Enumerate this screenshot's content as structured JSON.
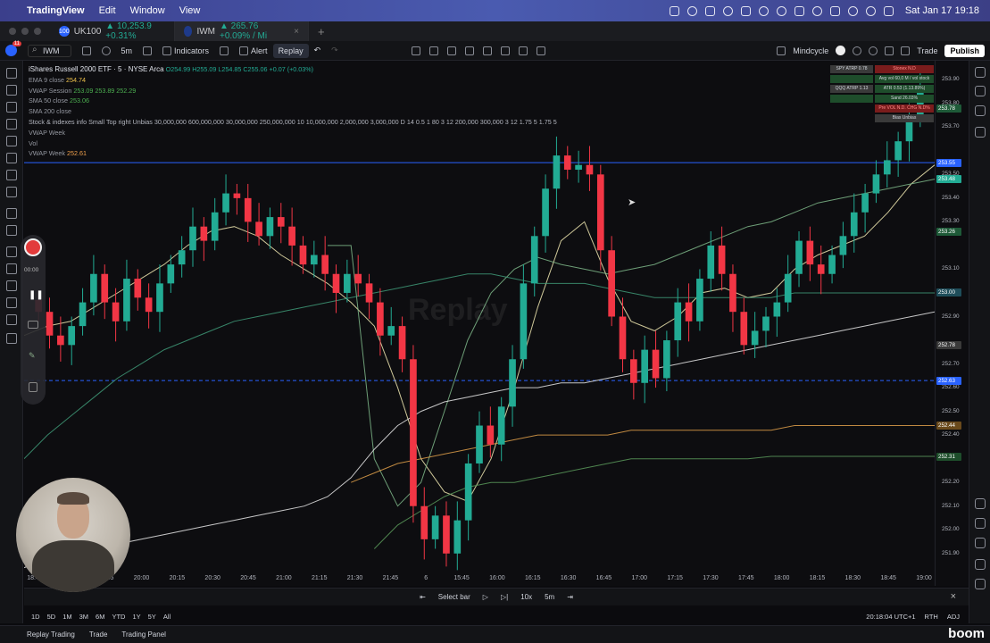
{
  "menubar": {
    "app": "TradingView",
    "menus": [
      "Edit",
      "Window",
      "View"
    ],
    "clock": "Sat Jan 17  19:18"
  },
  "tabs": [
    {
      "icon": "100",
      "symbol": "UK100",
      "change": "▲ 10,253.9 +0.31%"
    },
    {
      "icon": "",
      "symbol": "IWM",
      "change": "▲ 265.76 +0.09% / Mi"
    }
  ],
  "toolbar": {
    "symbol": "IWM",
    "interval": "5m",
    "indicators": "Indicators",
    "alert": "Alert",
    "replay": "Replay",
    "layout_name": "Mindcycle",
    "trade": "Trade",
    "publish": "Publish",
    "notif_count": "11"
  },
  "legend": {
    "title": "iShares Russell 2000 ETF · 5 · NYSE Arca",
    "ohlc": "O254.99 H255.09 L254.85 C255.06 +0.07 (+0.03%)",
    "lines": [
      {
        "label": "EMA 9 close",
        "value": "254.74",
        "color": "#f0c24c"
      },
      {
        "label": "VWAP Session",
        "value": "253.09  253.89  252.29",
        "color": "#4caf50"
      },
      {
        "label": "SMA 50 close",
        "value": "253.06",
        "color": "#4caf50"
      },
      {
        "label": "SMA 200 close",
        "value": "",
        "color": "#6f7280"
      },
      {
        "label": "Stock & indexes info Small Top right Unbias 30,000,000 600,000,000 30,000,000 250,000,000 10 10,000,000 2,000,000 3,000,000 D 14 0.5 1 80 3 12 200,000 300,000 3 12 1.75 5 1.75 5",
        "value": "",
        "color": "#b2b5be"
      },
      {
        "label": "VWAP Week",
        "value": "",
        "color": "#6f7280"
      },
      {
        "label": "Vol",
        "value": "",
        "color": "#6f7280"
      },
      {
        "label": "VWAP Week",
        "value": "252.61",
        "color": "#f0a04c"
      }
    ]
  },
  "watermark": "Replay",
  "info_table": {
    "rows": [
      [
        {
          "t": "SPY ATRP 0.78",
          "bg": "#3a3a3a"
        },
        {
          "t": "Stonex N.D",
          "bg": "#7a1c1c"
        }
      ],
      [
        {
          "t": "",
          "bg": "#1e4d2b"
        },
        {
          "t": "Avg vol 60,0 M / vol stock",
          "bg": "#1e4d2b"
        }
      ],
      [
        {
          "t": "QQQ ATRP 1.13",
          "bg": "#3a3a3a"
        },
        {
          "t": "ATR 0.53 (1.13.89%)",
          "bg": "#1e4d2b"
        }
      ],
      [
        {
          "t": "",
          "bg": "#1e4d2b"
        },
        {
          "t": "Sand 26.03%",
          "bg": "#1e4d2b"
        }
      ],
      [
        {
          "t": "",
          "bg": "#0d0d10"
        },
        {
          "t": "Pre VOL N.D. CHG N.D%",
          "bg": "#7a1c1c"
        }
      ],
      [
        {
          "t": "",
          "bg": "#0d0d10"
        },
        {
          "t": "Bias Unbias",
          "bg": "#3a3a3a"
        }
      ]
    ]
  },
  "chart_data": {
    "type": "candlestick",
    "ylim": [
      251.82,
      253.98
    ],
    "price_ticks": [
      "253.90",
      "253.80",
      "253.70",
      "253.50",
      "253.40",
      "253.30",
      "253.10",
      "252.90",
      "252.70",
      "252.60",
      "252.50",
      "252.40",
      "252.20",
      "252.10",
      "252.00",
      "251.90"
    ],
    "price_tags": [
      {
        "t": "253.78",
        "v": 253.78,
        "c": "#1e5a38"
      },
      {
        "t": "253.55",
        "v": 253.55,
        "c": "#2962ff"
      },
      {
        "t": "253.48",
        "v": 253.48,
        "c": "#22ab94"
      },
      {
        "t": "253.26",
        "v": 253.26,
        "c": "#1e5a38"
      },
      {
        "t": "253.00",
        "v": 253.0,
        "c": "#1e4d5a"
      },
      {
        "t": "252.78",
        "v": 252.78,
        "c": "#3a3a3a"
      },
      {
        "t": "252.63",
        "v": 252.63,
        "c": "#2962ff"
      },
      {
        "t": "252.44",
        "v": 252.44,
        "c": "#6a4a1c"
      },
      {
        "t": "252.31",
        "v": 252.31,
        "c": "#1e4d2b"
      }
    ],
    "time_ticks": [
      "18:45",
      "19:30",
      "19:45",
      "20:00",
      "20:15",
      "20:30",
      "20:45",
      "21:00",
      "21:15",
      "21:30",
      "21:45",
      "6",
      "15:45",
      "16:00",
      "16:15",
      "16:30",
      "16:45",
      "17:00",
      "17:15",
      "17:30",
      "17:45",
      "18:00",
      "18:15",
      "18:30",
      "18:45",
      "19:00"
    ],
    "hlines": [
      {
        "v": 253.55,
        "color": "#2962ff",
        "style": "solid"
      },
      {
        "v": 252.63,
        "color": "#2962ff",
        "style": "dashed"
      }
    ],
    "closes": [
      252.92,
      252.82,
      252.78,
      252.86,
      252.96,
      253.08,
      252.96,
      252.88,
      253.06,
      252.98,
      252.92,
      253.04,
      253.12,
      253.18,
      253.28,
      253.22,
      253.34,
      253.42,
      253.4,
      253.3,
      253.24,
      253.32,
      253.28,
      253.2,
      253.12,
      253.16,
      253.08,
      253.0,
      253.08,
      253.04,
      252.96,
      252.82,
      252.86,
      252.72,
      252.1,
      251.96,
      252.06,
      251.9,
      252.04,
      252.28,
      252.44,
      252.36,
      252.52,
      252.72,
      253.04,
      253.24,
      253.44,
      253.58,
      253.52,
      253.54,
      253.5,
      253.18,
      252.9,
      252.72,
      252.62,
      252.76,
      252.64,
      252.8,
      252.96,
      252.88,
      253.06,
      253.2,
      253.08,
      252.92,
      252.78,
      252.84,
      252.9,
      252.96,
      253.08,
      253.22,
      253.12,
      253.08,
      253.16,
      253.24,
      253.34,
      253.42,
      253.5,
      253.56,
      253.64,
      253.74,
      253.86
    ],
    "series": [
      {
        "name": "EMA 9",
        "color": "#f0e8b0",
        "values": [
          252.82,
          252.86,
          252.88,
          252.94,
          253.0,
          253.06,
          253.12,
          253.2,
          253.26,
          253.28,
          253.24,
          253.16,
          253.1,
          253.04,
          252.96,
          252.86,
          252.6,
          252.3,
          252.16,
          252.12,
          252.3,
          252.6,
          252.94,
          253.22,
          253.3,
          253.06,
          252.88,
          252.84,
          252.9,
          253.0,
          253.02,
          252.98,
          253.0,
          253.1,
          253.16,
          253.2,
          253.24,
          253.34,
          253.46,
          253.54
        ]
      },
      {
        "name": "VWAP Session",
        "color": "#7fb88a",
        "values": [
          null,
          null,
          null,
          null,
          null,
          null,
          null,
          null,
          null,
          null,
          null,
          null,
          null,
          253.2,
          253.2,
          252.3,
          252.1,
          252.2,
          252.5,
          252.8,
          253.0,
          253.1,
          253.15,
          253.12,
          253.1,
          253.08,
          253.1,
          253.12,
          253.16,
          253.2,
          253.24,
          253.28,
          253.3,
          253.34,
          253.38,
          253.4,
          253.42,
          253.44,
          253.46,
          253.48
        ]
      },
      {
        "name": "SMA 50",
        "color": "#3f9a78",
        "values": [
          252.3,
          252.4,
          252.48,
          252.56,
          252.64,
          252.7,
          252.76,
          252.8,
          252.84,
          252.88,
          252.9,
          252.92,
          252.94,
          252.96,
          252.98,
          253.0,
          253.02,
          253.04,
          253.06,
          253.08,
          253.08,
          253.06,
          253.04,
          253.04,
          253.04,
          253.02,
          253.0,
          252.98,
          252.98,
          252.98,
          252.98,
          252.98,
          252.98,
          253.0,
          253.0,
          253.0,
          253.0,
          253.0,
          253.0,
          253.0
        ]
      },
      {
        "name": "SMA 200",
        "color": "#e8e8e8",
        "values": [
          251.84,
          251.88,
          251.9,
          251.92,
          251.94,
          251.96,
          251.98,
          252.0,
          252.02,
          252.04,
          252.06,
          252.08,
          252.1,
          252.14,
          252.22,
          252.34,
          252.44,
          252.5,
          252.54,
          252.56,
          252.58,
          252.6,
          252.6,
          252.62,
          252.62,
          252.64,
          252.66,
          252.68,
          252.7,
          252.72,
          252.74,
          252.76,
          252.78,
          252.8,
          252.82,
          252.84,
          252.86,
          252.88,
          252.9,
          252.92
        ]
      },
      {
        "name": "VWAP Week",
        "color": "#e0a04a",
        "values": [
          null,
          null,
          null,
          null,
          null,
          null,
          null,
          null,
          null,
          null,
          null,
          null,
          null,
          null,
          252.2,
          252.24,
          252.28,
          252.3,
          252.32,
          252.34,
          252.36,
          252.38,
          252.4,
          252.4,
          252.4,
          252.4,
          252.42,
          252.42,
          252.42,
          252.42,
          252.42,
          252.42,
          252.42,
          252.44,
          252.44,
          252.44,
          252.44,
          252.44,
          252.44,
          252.44
        ]
      },
      {
        "name": "SMA band",
        "color": "#5a9a5a",
        "values": [
          null,
          null,
          null,
          null,
          null,
          null,
          null,
          null,
          null,
          null,
          null,
          null,
          null,
          null,
          null,
          251.92,
          252.02,
          252.08,
          252.14,
          252.18,
          252.2,
          252.2,
          252.22,
          252.24,
          252.26,
          252.28,
          252.3,
          252.3,
          252.3,
          252.3,
          252.3,
          252.3,
          252.31,
          252.31,
          252.31,
          252.31,
          252.31,
          252.31,
          252.31,
          252.31
        ]
      }
    ]
  },
  "replay_bar": {
    "select_bar": "Select bar",
    "speed": "10x",
    "interval": "5m"
  },
  "ranges": {
    "items": [
      "1D",
      "5D",
      "1M",
      "3M",
      "6M",
      "YTD",
      "1Y",
      "5Y",
      "All"
    ],
    "clock": "20:18:04 UTC+1",
    "session": "RTH",
    "adj": "ADJ"
  },
  "bottom_panel": {
    "tabs": [
      "Replay Trading",
      "Trade",
      "Trading Panel"
    ],
    "brand": "boom"
  },
  "recorder": {
    "time": "00:00"
  }
}
